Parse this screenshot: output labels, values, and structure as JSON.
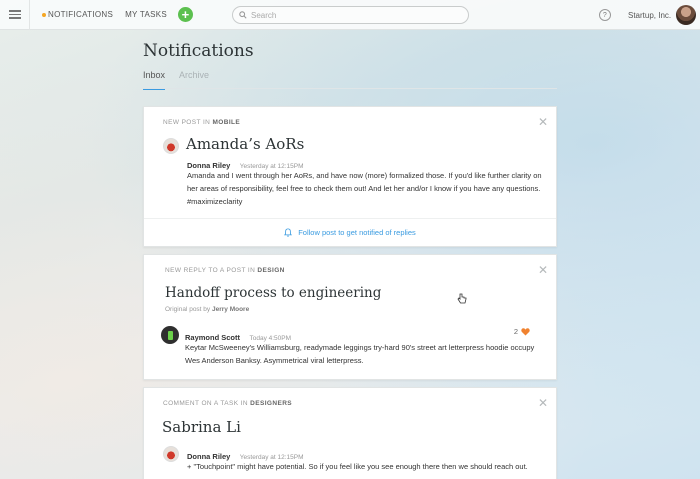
{
  "nav": {
    "notifications": "NOTIFICATIONS",
    "my_tasks": "MY TASKS",
    "add": "+",
    "search_placeholder": "Search",
    "help": "?",
    "org": "Startup, Inc."
  },
  "page": {
    "title": "Notifications",
    "tabs": [
      "Inbox",
      "Archive"
    ]
  },
  "cards": [
    {
      "context_prefix": "NEW POST IN",
      "context_target": "MOBILE",
      "title": "Amanda’s AoRs",
      "author": "Donna Riley",
      "time": "Yesterday at 12:15PM",
      "body": "Amanda and I went through her AoRs, and have now (more) formalized those. If you'd like further clarity on her areas of responsibility, feel free to check them out! And let her and/or I know if you have any questions. #maximizeclarity",
      "follow": "Follow post to get notified of replies"
    },
    {
      "context_prefix": "NEW REPLY TO A POST IN",
      "context_target": "DESIGN",
      "title": "Handoff process to engineering",
      "original_prefix": "Original post by",
      "original_author": "Jerry Moore",
      "reply_author": "Raymond Scott",
      "reply_time": "Today 4:50PM",
      "likes": "2",
      "reply_body": "Keytar McSweeney's Williamsburg, readymade leggings try-hard 90's street art letterpress hoodie occupy Wes Anderson Banksy. Asymmetrical viral letterpress."
    },
    {
      "context_prefix": "COMMENT ON A TASK IN",
      "context_target": "DESIGNERS",
      "title": "Sabrina Li",
      "author": "Donna Riley",
      "time": "Yesterday at 12:15PM",
      "body": "+ \"Touchpoint\" might have potential. So if you feel like you see enough there then we should reach out."
    }
  ],
  "colors": {
    "accent": "#3a9be0",
    "add_button": "#5cc04f",
    "like": "#f0822f",
    "unread_dot": "#f5a623"
  }
}
